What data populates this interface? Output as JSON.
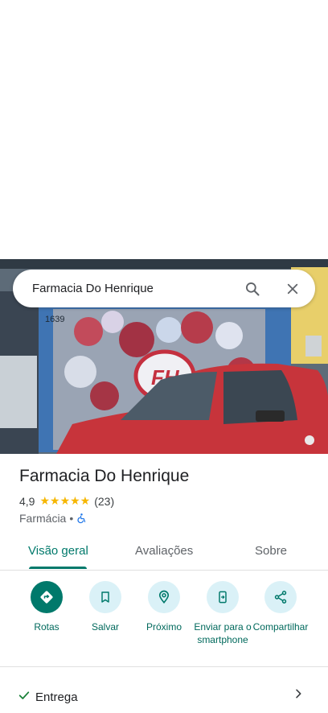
{
  "search": {
    "query": "Farmacia Do Henrique"
  },
  "photo": {
    "storefront_number": "1639"
  },
  "place": {
    "title": "Farmacia Do Henrique",
    "rating": "4,9",
    "stars": "★★★★★",
    "rating_value": 4.9,
    "review_count": "(23)",
    "category": "Farmácia",
    "separator": "•"
  },
  "tabs": [
    {
      "label": "Visão geral",
      "active": true
    },
    {
      "label": "Avaliações",
      "active": false
    },
    {
      "label": "Sobre",
      "active": false
    }
  ],
  "actions": [
    {
      "label": "Rotas",
      "icon": "directions-icon"
    },
    {
      "label": "Salvar",
      "icon": "bookmark-icon"
    },
    {
      "label": "Próximo",
      "icon": "nearby-icon"
    },
    {
      "label": "Enviar para o smartphone",
      "icon": "send-to-phone-icon"
    },
    {
      "label": "Compartilhar",
      "icon": "share-icon"
    }
  ],
  "delivery": {
    "label": "Entrega",
    "icon": "check-icon"
  },
  "colors": {
    "accent": "#00796b",
    "action_bg": "#daf1f7",
    "star": "#f6b600",
    "accessible": "#1a73e8"
  }
}
